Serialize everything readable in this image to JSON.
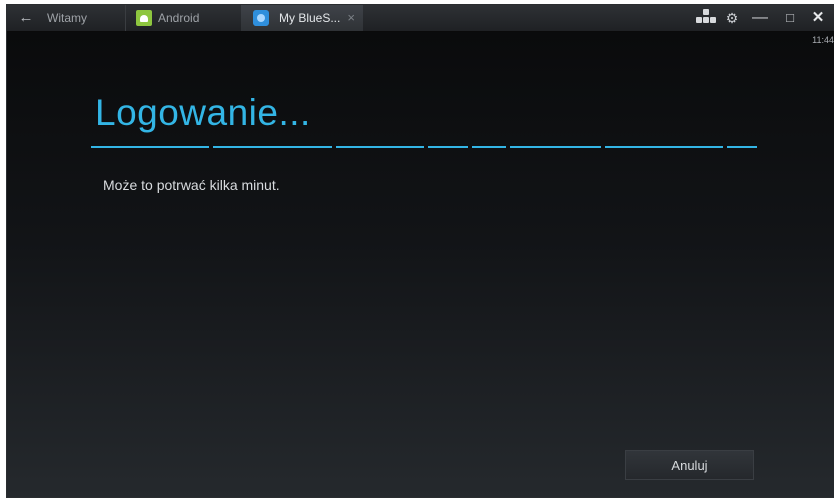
{
  "tabbar": {
    "back_icon": "arrow-left-icon",
    "tabs": [
      {
        "label": "Witamy",
        "icon": "none"
      },
      {
        "label": "Android",
        "icon": "android-icon"
      },
      {
        "label": "My BlueS...",
        "icon": "bluestacks-icon",
        "active": true
      }
    ],
    "close_tab_glyph": "×",
    "controls": {
      "keyboard_icon": "keyboard-layout-icon",
      "gear_glyph": "⚙",
      "minimize_glyph": "—",
      "maximize_glyph": "□",
      "close_glyph": "✕"
    }
  },
  "status": {
    "time": "11:44"
  },
  "dialog": {
    "title": "Logowanie...",
    "subtitle": "Może to potrwać kilka minut.",
    "cancel_label": "Anuluj"
  },
  "colors": {
    "accent": "#33b5e5",
    "background": "#0b0c0d",
    "android_green": "#8ec63f",
    "bluestacks_blue": "#2f8fdc"
  }
}
